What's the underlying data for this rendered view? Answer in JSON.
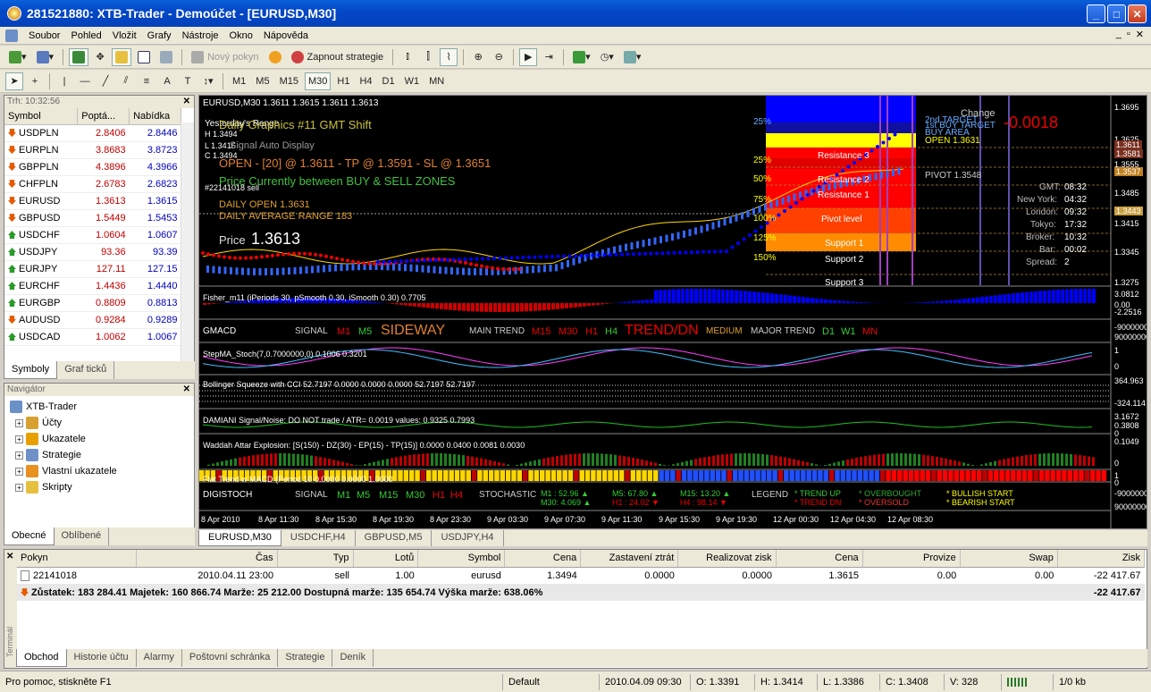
{
  "window": {
    "title": "281521880: XTB-Trader - Demoúčet - [EURUSD,M30]"
  },
  "menu": [
    "Soubor",
    "Pohled",
    "Vložit",
    "Grafy",
    "Nástroje",
    "Okno",
    "Nápověda"
  ],
  "toolbar": {
    "new_order": "Nový pokyn",
    "strategies": "Zapnout strategie"
  },
  "timeframes": [
    "M1",
    "M5",
    "M15",
    "M30",
    "H1",
    "H4",
    "D1",
    "W1",
    "MN"
  ],
  "market_watch": {
    "header": "Trh: 10:32:56",
    "columns": [
      "Symbol",
      "Poptá...",
      "Nabídka"
    ],
    "rows": [
      {
        "symbol": "USDPLN",
        "bid": "2.8406",
        "ask": "2.8446",
        "dir": "dn"
      },
      {
        "symbol": "EURPLN",
        "bid": "3.8683",
        "ask": "3.8723",
        "dir": "dn"
      },
      {
        "symbol": "GBPPLN",
        "bid": "4.3896",
        "ask": "4.3966",
        "dir": "dn"
      },
      {
        "symbol": "CHFPLN",
        "bid": "2.6783",
        "ask": "2.6823",
        "dir": "dn"
      },
      {
        "symbol": "EURUSD",
        "bid": "1.3613",
        "ask": "1.3615",
        "dir": "dn"
      },
      {
        "symbol": "GBPUSD",
        "bid": "1.5449",
        "ask": "1.5453",
        "dir": "dn"
      },
      {
        "symbol": "USDCHF",
        "bid": "1.0604",
        "ask": "1.0607",
        "dir": "up"
      },
      {
        "symbol": "USDJPY",
        "bid": "93.36",
        "ask": "93.39",
        "dir": "up"
      },
      {
        "symbol": "EURJPY",
        "bid": "127.11",
        "ask": "127.15",
        "dir": "up"
      },
      {
        "symbol": "EURCHF",
        "bid": "1.4436",
        "ask": "1.4440",
        "dir": "up"
      },
      {
        "symbol": "EURGBP",
        "bid": "0.8809",
        "ask": "0.8813",
        "dir": "up"
      },
      {
        "symbol": "AUDUSD",
        "bid": "0.9284",
        "ask": "0.9289",
        "dir": "dn"
      },
      {
        "symbol": "USDCAD",
        "bid": "1.0062",
        "ask": "1.0067",
        "dir": "up"
      }
    ],
    "tabs": [
      "Symboly",
      "Graf ticků"
    ]
  },
  "navigator": {
    "header": "Navigátor",
    "root": "XTB-Trader",
    "items": [
      "Účty",
      "Ukazatele",
      "Strategie",
      "Vlastní ukazatele",
      "Skripty"
    ],
    "tabs": [
      "Obecné",
      "Oblíbené"
    ]
  },
  "chart": {
    "header": "EURUSD,M30  1.3611 1.3615 1.3611 1.3613",
    "yesterday": "Yesterday's Range",
    "yH": "H 1.3494",
    "yL": "L 1.3416",
    "yC": "C 1.3494",
    "title1": "Daily Graphics #11 GMT Shift",
    "title2": "Signal Auto Display",
    "signal": "OPEN - [20] @ 1.3611 - TP @ 1.3591 - SL @ 1.3651",
    "zone": "Price Currently between BUY & SELL ZONES",
    "trade": "#22141018 sell",
    "daily_open": "DAILY OPEN    1.3631",
    "dar": "DAILY AVERAGE RANGE  183",
    "price_label": "Price",
    "price": "1.3613",
    "pct": [
      "25%",
      "25%",
      "50%",
      "75%",
      "100%",
      "125%",
      "150%"
    ],
    "levels": [
      "Resistance 3",
      "Resistance 2",
      "Resistance 1",
      "Pivot level",
      "Support 1",
      "Support 2",
      "Support 3"
    ],
    "change_label": "Change",
    "change": "-0.0018",
    "target": "2nd TARGET",
    "buy_target": "1st BUY TARGET",
    "buy_area": "BUY AREA",
    "open_right": "OPEN 1.3631",
    "pivot_right": "PIVOT 1.3548",
    "sessions": [
      [
        "GMT:",
        "08:32"
      ],
      [
        "New York:",
        "04:32"
      ],
      [
        "London:",
        "09:32"
      ],
      [
        "Tokyo:",
        "17:32"
      ],
      [
        "Broker:",
        "10:32"
      ],
      [
        "Bar:",
        "00:02"
      ],
      [
        "Spread:",
        "2"
      ]
    ],
    "price_scale": [
      "1.3695",
      "1.3625",
      "1.3611",
      "1.3581",
      "1.3555",
      "1.3537",
      "1.3485",
      "1.3443",
      "1.3415",
      "1.3345",
      "1.3275"
    ],
    "fisher": "Fisher_m11  (iPeriods 30, pSmooth 0.30, iSmooth 0.30)  0.7705",
    "fisher_scale": [
      "3.0812",
      "0.00",
      "-2.2516"
    ],
    "gmacd": {
      "name": "GMACD",
      "signal": "SIGNAL",
      "m1": "M1",
      "m5": "M5",
      "sideway": "SIDEWAY",
      "main": "MAIN TREND",
      "m15": "M15",
      "m30": "M30",
      "h1": "H1",
      "h4": "H4",
      "trend": "TREND/DN",
      "medium": "MEDIUM",
      "major": "MAJOR TREND",
      "d1": "D1",
      "w1": "W1",
      "mn": "MN"
    },
    "gmacd_scale": [
      "-9000000",
      "90000000"
    ],
    "stoch": "StepMA_Stoch(7,0.7000000,0) 0.1006 0.3201",
    "stoch_scale": [
      "1",
      "0"
    ],
    "bollinger": "Bollinger Squeeze with CCI 52.7197 0.0000 0.0000 0.0000 52.7197 52.7197",
    "bollinger_scale": [
      "364.963",
      "-324.114"
    ],
    "damiani": "DAMIANI Signal/Noise: DO NOT trade   /   ATR= 0.0019      values: 0.9325  0.7993",
    "damiani_scale": [
      "3.1672",
      "0.3808",
      "0"
    ],
    "waddah": "Waddah Attar Explosion: [S(150) - DZ(30) - EP(15) - TP(15)] 0.0000 0.0400 0.0081 0.0030",
    "waddah_scale": [
      "0.1049",
      "0"
    ],
    "flat": "Flat Trend w MACD (Period 10 0.0000 0.0000 1.0000",
    "flat_scale": [
      "1",
      "0"
    ],
    "digistoch": {
      "name": "DIGISTOCH",
      "signal": "SIGNAL",
      "m1": "M1",
      "m5": "M5",
      "m15": "M15",
      "m30": "M30",
      "h1": "H1",
      "h4": "H4",
      "stochastic": "STOCHASTIC",
      "v1": "M1  : 52.96 ▲",
      "v2": "M30: 4.069 ▲",
      "v3": "M5: 67.80 ▲",
      "v4": "H1 : 24.02 ▼",
      "v5": "M15: 13.20 ▲",
      "v6": "H4  : 98.14 ▼",
      "legend": "LEGEND",
      "l1": "* TREND UP",
      "l2": "* TREND DN",
      "l3": "* OVERBOUGHT",
      "l4": "* OVERSOLD",
      "l5": "* BULLISH START",
      "l6": "* BEARISH START"
    },
    "digi_scale": [
      "-9000000",
      "90000000"
    ],
    "time_axis": [
      "8 Apr 2010",
      "8 Apr 11:30",
      "8 Apr 15:30",
      "8 Apr 19:30",
      "8 Apr 23:30",
      "9 Apr 03:30",
      "9 Apr 07:30",
      "9 Apr 11:30",
      "9 Apr 15:30",
      "9 Apr 19:30",
      "12 Apr 00:30",
      "12 Apr 04:30",
      "12 Apr 08:30"
    ],
    "tabs": [
      "EURUSD,M30",
      "USDCHF,H4",
      "GBPUSD,M5",
      "USDJPY,H4"
    ],
    "colors": {
      "bg": "#000000",
      "resist": "#ff0000",
      "support": "#ff8c00",
      "buy": "#0000ff"
    }
  },
  "terminal": {
    "columns": [
      "Pokyn",
      "Čas",
      "Typ",
      "Lotů",
      "Symbol",
      "Cena",
      "Zastavení ztrát",
      "Realizovat zisk",
      "Cena",
      "Provize",
      "Swap",
      "Zisk"
    ],
    "row": [
      "22141018",
      "2010.04.11 23:00",
      "sell",
      "1.00",
      "eurusd",
      "1.3494",
      "0.0000",
      "0.0000",
      "1.3615",
      "0.00",
      "0.00",
      "-22 417.67"
    ],
    "balance": "Zůstatek: 183 284.41  Majetek: 160 866.74  Marže: 25 212.00  Dostupná marže: 135 654.74  Výška marže: 638.06%",
    "balance_profit": "-22 417.67",
    "side": "Terminál",
    "tabs": [
      "Obchod",
      "Historie účtu",
      "Alarmy",
      "Poštovní schránka",
      "Strategie",
      "Deník"
    ]
  },
  "status": {
    "help": "Pro pomoc, stiskněte F1",
    "profile": "Default",
    "datetime": "2010.04.09 09:30",
    "open": "O: 1.3391",
    "high": "H: 1.3414",
    "low": "L: 1.3386",
    "close": "C: 1.3408",
    "volume": "V: 328",
    "traffic": "1/0 kb"
  }
}
